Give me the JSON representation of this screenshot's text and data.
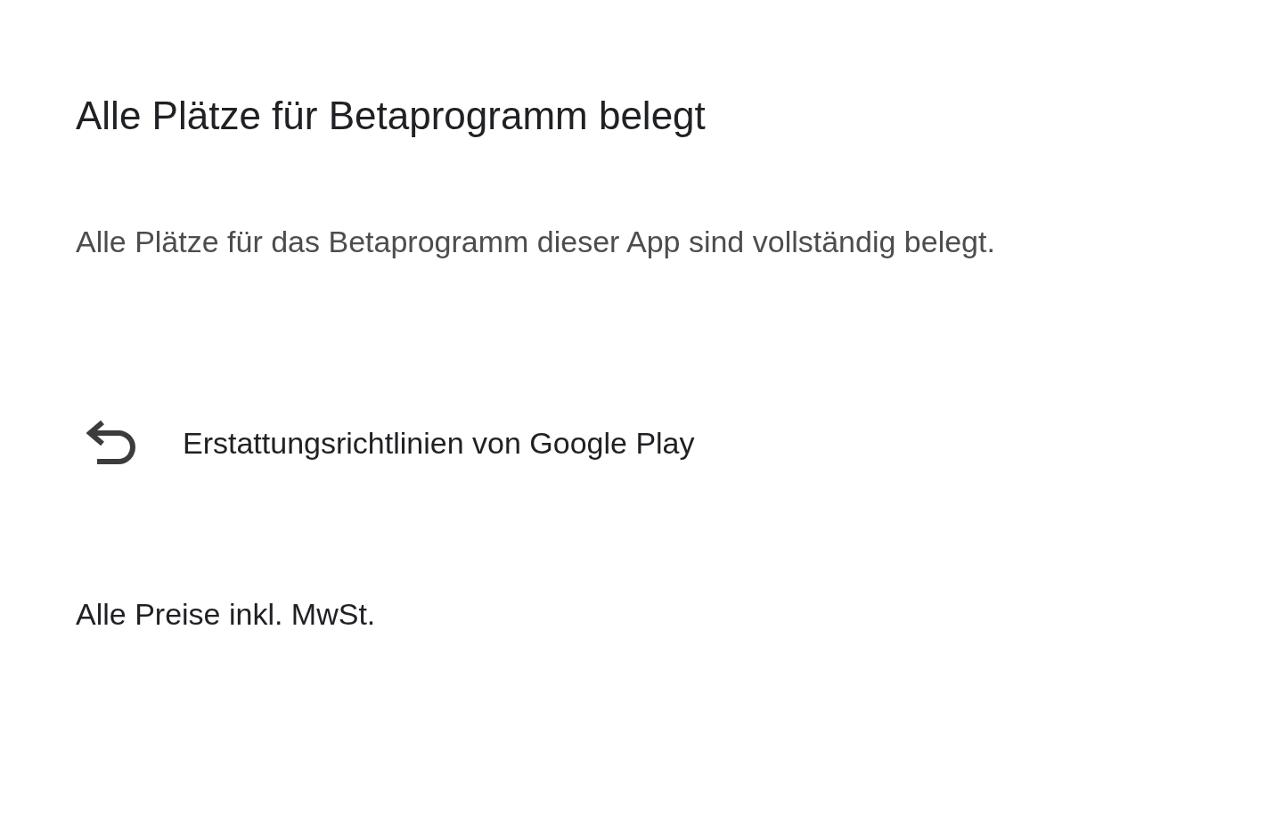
{
  "dialog": {
    "title": "Alle Plätze für Betaprogramm belegt",
    "message": "Alle Plätze für das Betaprogramm dieser App sind vollständig belegt.",
    "link": {
      "label": "Erstattungsrichtlinien von Google Play"
    },
    "footer": "Alle Preise inkl. MwSt."
  }
}
